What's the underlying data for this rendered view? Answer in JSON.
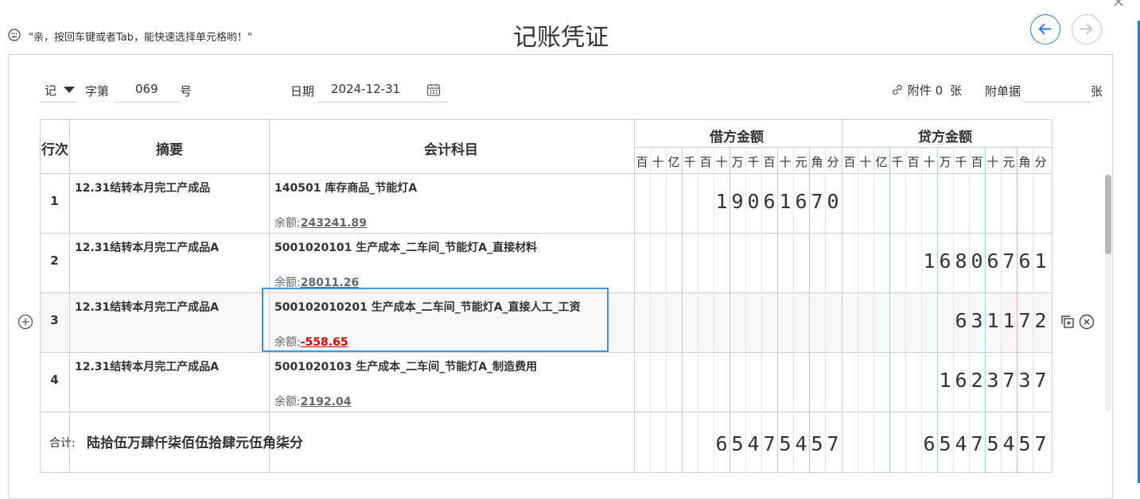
{
  "hint": "\"亲，按回车键或者Tab，能快速选择单元格哟！\"",
  "title": "记账凭证",
  "header": {
    "voucher_type": "记",
    "zi_label": "字第",
    "voucher_no": "069",
    "hao_label": "号",
    "date_label": "日期",
    "date_value": "2024-12-31",
    "attach_label": "附件",
    "attach_count": "0",
    "attach_unit": "张",
    "bill_label": "附单据",
    "bill_value": "",
    "bill_unit": "张"
  },
  "table": {
    "col_row": "行次",
    "col_summary": "摘要",
    "col_account": "会计科目",
    "col_debit": "借方金额",
    "col_credit": "贷方金额",
    "units": [
      "百",
      "十",
      "亿",
      "千",
      "百",
      "十",
      "万",
      "千",
      "百",
      "十",
      "元",
      "角",
      "分"
    ],
    "balance_label": "余额:",
    "rows": [
      {
        "no": "1",
        "summary": "12.31结转本月完工产成品",
        "account": "140501 库存商品_节能灯A",
        "balance": "243241.89",
        "debit": "19061670",
        "credit": ""
      },
      {
        "no": "2",
        "summary": "12.31结转本月完工产成品A",
        "account": "5001020101 生产成本_二车间_节能灯A_直接材料",
        "balance": "28011.26",
        "debit": "",
        "credit": "16806761"
      },
      {
        "no": "3",
        "summary": "12.31结转本月完工产成品A",
        "account": "500102010201 生产成本_二车间_节能灯A_直接人工_工资",
        "balance": "-558.65",
        "debit": "",
        "credit": "631172"
      },
      {
        "no": "4",
        "summary": "12.31结转本月完工产成品A",
        "account": "5001020103 生产成本_二车间_节能灯A_制造费用",
        "balance": "2192.04",
        "debit": "",
        "credit": "1623737"
      }
    ],
    "total_label": "合计:",
    "total_words": "陆拾伍万肆仟柒佰伍拾肆元伍角柒分",
    "total_debit": "65475457",
    "total_credit": "65475457"
  },
  "colors": {
    "accent": "#2d7bd8",
    "selection": "#3d97e6",
    "negative": "#e00000"
  }
}
